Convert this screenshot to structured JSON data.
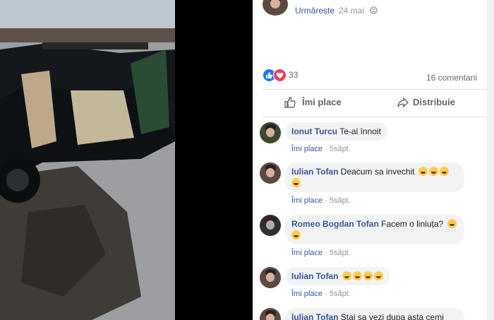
{
  "post": {
    "follow_label": "Urmărește",
    "separator": "·",
    "date": "24 mai",
    "reaction_count": "33",
    "comments_count": "16 comentarii",
    "like_label": "Îmi place",
    "share_label": "Distribuie"
  },
  "comments": [
    {
      "author": "Ionut Turcu",
      "text": "Te-ai înnoit",
      "like": "Îmi place",
      "sep": "·",
      "time": "5săpt."
    },
    {
      "author": "Iulian Tofan",
      "text": "Deacum sa invechit",
      "like": "Îmi place",
      "sep": "·",
      "time": "5săpt."
    },
    {
      "author": "Romeo Bogdan Tofan",
      "text": "Facem o liniuța?",
      "like": "Îmi place",
      "sep": "·",
      "time": "5săpt."
    },
    {
      "author": "Iulian Tofan",
      "text": "",
      "like": "Îmi place",
      "sep": "·",
      "time": "5săpt."
    },
    {
      "author": "Iulian Tofan",
      "text": "Stai sa vezi dupa asta cemi"
    }
  ],
  "colors": {
    "link": "#385898",
    "like": "#1877f2",
    "love": "#f33e58",
    "bubble": "#f2f3f5"
  }
}
